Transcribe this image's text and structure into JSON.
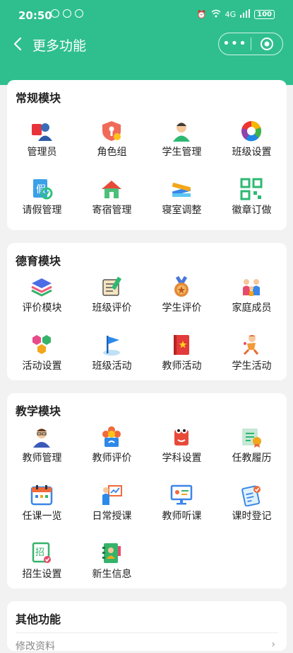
{
  "status": {
    "time": "20:50",
    "signal": "4G",
    "battery": "100"
  },
  "nav": {
    "title": "更多功能",
    "more": "•••"
  },
  "sections": [
    {
      "title": "常规模块",
      "items": [
        {
          "label": "管理员",
          "icon": "admin-icon"
        },
        {
          "label": "角色组",
          "icon": "role-group-icon"
        },
        {
          "label": "学生管理",
          "icon": "student-icon"
        },
        {
          "label": "班级设置",
          "icon": "class-settings-icon"
        },
        {
          "label": "请假管理",
          "icon": "leave-icon"
        },
        {
          "label": "寄宿管理",
          "icon": "boarding-icon"
        },
        {
          "label": "寝室调整",
          "icon": "dorm-icon"
        },
        {
          "label": "徽章订做",
          "icon": "badge-qr-icon"
        }
      ]
    },
    {
      "title": "德育模块",
      "items": [
        {
          "label": "评价模块",
          "icon": "layers-icon"
        },
        {
          "label": "班级评价",
          "icon": "class-evaluation-icon"
        },
        {
          "label": "学生评价",
          "icon": "medal-icon"
        },
        {
          "label": "家庭成员",
          "icon": "family-icon"
        },
        {
          "label": "活动设置",
          "icon": "hexagons-icon"
        },
        {
          "label": "班级活动",
          "icon": "flag-icon"
        },
        {
          "label": "教师活动",
          "icon": "red-book-icon"
        },
        {
          "label": "学生活动",
          "icon": "running-student-icon"
        }
      ]
    },
    {
      "title": "教学模块",
      "items": [
        {
          "label": "教师管理",
          "icon": "teacher-icon"
        },
        {
          "label": "教师评价",
          "icon": "flower-badge-icon"
        },
        {
          "label": "学科设置",
          "icon": "book-character-icon"
        },
        {
          "label": "任教履历",
          "icon": "certificate-icon"
        },
        {
          "label": "任课一览",
          "icon": "calendar-icon"
        },
        {
          "label": "日常授课",
          "icon": "lecture-icon"
        },
        {
          "label": "教师听课",
          "icon": "monitor-icon"
        },
        {
          "label": "课时登记",
          "icon": "clipboard-icon"
        },
        {
          "label": "招生设置",
          "icon": "enroll-icon"
        },
        {
          "label": "新生信息",
          "icon": "contact-book-icon"
        }
      ]
    }
  ],
  "other": {
    "title": "其他功能",
    "first_item": "修改资料"
  },
  "colors": {
    "header": "#2fbf8f"
  }
}
